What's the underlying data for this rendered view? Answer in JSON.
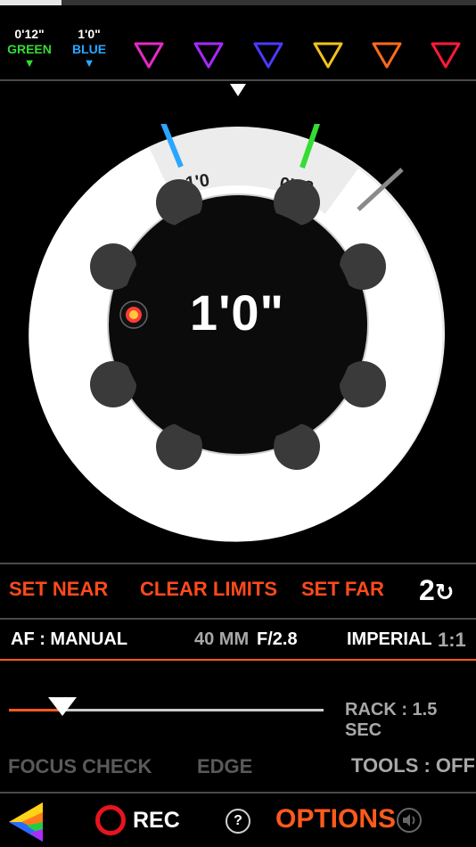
{
  "top_progress": 0.13,
  "markers": [
    {
      "value": "0'12\"",
      "label": "GREEN",
      "color": "#33dd33"
    },
    {
      "value": "1'0\"",
      "label": "BLUE",
      "color": "#2aa6ff"
    }
  ],
  "color_triangles": [
    "#e62ac8",
    "#a72aff",
    "#4a3bff",
    "#f2c21a",
    "#ff6a1c",
    "#ff1a3a"
  ],
  "dial": {
    "current": "1'0\"",
    "ring_marks": [
      {
        "label": "1'0",
        "color": "#2aa6ff"
      },
      {
        "label": "0'12",
        "color": "#33dd33"
      }
    ],
    "limit_color": "#8a8a8a"
  },
  "actions": {
    "set_near": "SET NEAR",
    "clear_limits": "CLEAR LIMITS",
    "set_far": "SET FAR",
    "counter": "2"
  },
  "info": {
    "af": "AF : MANUAL",
    "focal": "40 MM",
    "aperture": "F/2.8",
    "units": "IMPERIAL",
    "ratio": "1:1"
  },
  "rack": {
    "label": "RACK : 1.5 SEC",
    "slider_value": 0.17
  },
  "tools": {
    "focus_check": "FOCUS CHECK",
    "edge": "EDGE",
    "tools": "TOOLS : OFF"
  },
  "bottom": {
    "rec": "REC",
    "help": "?",
    "options": "OPTIONS"
  },
  "colors": {
    "accent": "#ff5a1c",
    "rec_red": "#e8141e"
  }
}
